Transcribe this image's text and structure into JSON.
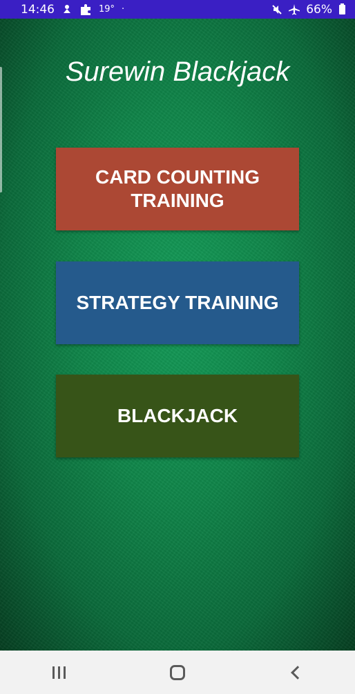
{
  "status_bar": {
    "time": "14:46",
    "temperature": "19°",
    "dot": "·",
    "battery": "66%",
    "icons": [
      "notification-icon",
      "puzzle-icon",
      "mute-icon",
      "airplane-icon",
      "battery-icon"
    ]
  },
  "app": {
    "title": "Surewin Blackjack"
  },
  "menu": {
    "card_counting_label": "CARD COUNTING TRAINING",
    "strategy_label": "STRATEGY TRAINING",
    "blackjack_label": "BLACKJACK"
  },
  "colors": {
    "status_bar": "#3a1fc4",
    "felt": "#0f8549",
    "card_counting_button": "#ac4834",
    "strategy_button": "#255a8c",
    "blackjack_button": "#375418",
    "nav_bar": "#f2f2f2"
  },
  "nav_bar": {
    "icons": [
      "recents-icon",
      "home-icon",
      "back-icon"
    ]
  }
}
